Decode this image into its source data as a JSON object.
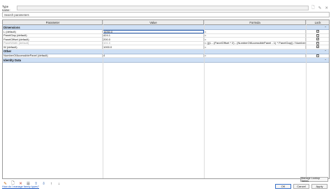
{
  "type_row": {
    "label": "Type name:"
  },
  "search": {
    "placeholder": "Search parameters"
  },
  "columns": {
    "parameter": "Parameter",
    "value": "Value",
    "formula": "Formula",
    "lock": "Lock"
  },
  "groups": [
    {
      "name": "Dimensions",
      "rows": [
        {
          "parameter": "L (default)",
          "value": "6050.0",
          "formula": "=",
          "lock": true,
          "editing": true
        },
        {
          "parameter": "PanelGap (default)",
          "value": "424.1",
          "formula": "=",
          "lock": true
        },
        {
          "parameter": "PanelOffset (default)",
          "value": "200.0",
          "formula": "=",
          "lock": true
        },
        {
          "parameter": "PanelWidth (default)",
          "value": "101.0",
          "formula": "= (((L - (PanelOffset * 2) - (NumberOfAccessiblePanel - 1) * PanelGap)) / NumberOfAc",
          "lock": true,
          "greyed": true
        },
        {
          "parameter": "W (default)",
          "value": "1000.0",
          "formula": "=",
          "lock": true
        }
      ]
    },
    {
      "name": "Other",
      "rows": [
        {
          "parameter": "NumberOfAccessiblePanel (default)",
          "value": "4",
          "formula": "=",
          "lock": true
        }
      ]
    },
    {
      "name": "Identity Data",
      "rows": []
    }
  ],
  "toolbar_icons": [
    "edit-pencil-icon",
    "new-parameter-icon",
    "delete-parameter-icon",
    "rename-icon",
    "move-up-icon",
    "move-down-icon",
    "sort-ascending-icon",
    "sort-descending-icon"
  ],
  "manage_lookup": "Manage Lookup Tables",
  "help_link": "How do I manage family types?",
  "buttons": {
    "ok": "OK",
    "cancel": "Cancel",
    "apply": "Apply"
  }
}
